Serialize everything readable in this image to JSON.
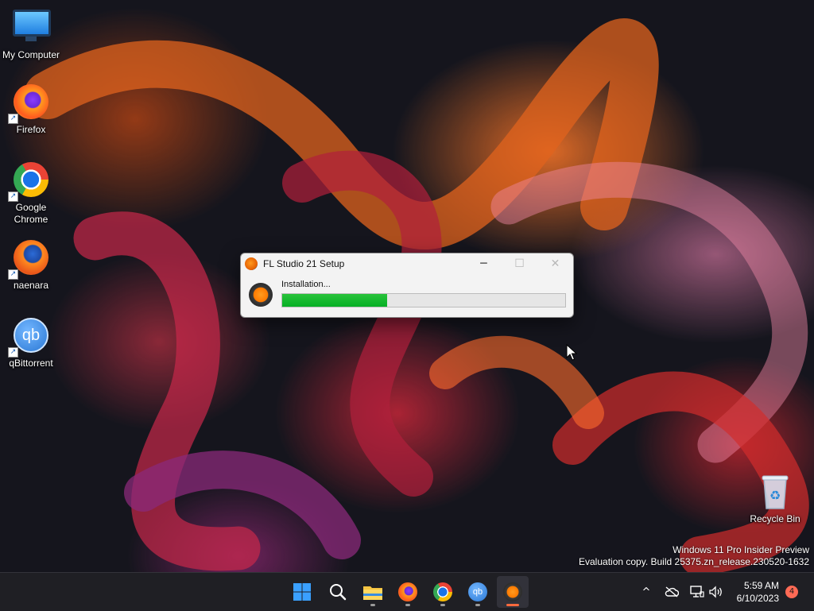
{
  "desktop": {
    "icons": [
      {
        "label": "My Computer",
        "icon": "monitor-icon"
      },
      {
        "label": "Firefox",
        "icon": "firefox-icon"
      },
      {
        "label": "Google\nChrome",
        "icon": "chrome-icon"
      },
      {
        "label": "naenara",
        "icon": "naenara-icon"
      },
      {
        "label": "qBittorrent",
        "icon": "qbittorrent-icon"
      },
      {
        "label": "Recycle Bin",
        "icon": "recycle-bin-icon"
      }
    ],
    "watermark": {
      "line1": "Windows 11 Pro Insider Preview",
      "line2": "Evaluation copy. Build 25375.zn_release.230520-1632"
    }
  },
  "setup_window": {
    "title": "FL Studio 21 Setup",
    "status": "Installation...",
    "progress": 0.37,
    "controls": {
      "minimize": "─",
      "maximize": "☐",
      "close": "✕"
    }
  },
  "qbittorrent_glyph": "qb",
  "taskbar": {
    "apps": [
      {
        "name": "start",
        "icon": "windows-logo-icon"
      },
      {
        "name": "search",
        "icon": "search-icon"
      },
      {
        "name": "file-explorer",
        "icon": "folder-icon"
      },
      {
        "name": "firefox",
        "icon": "firefox-icon"
      },
      {
        "name": "chrome",
        "icon": "chrome-icon"
      },
      {
        "name": "qbittorrent",
        "icon": "qbittorrent-icon"
      },
      {
        "name": "fl-studio",
        "icon": "fl-studio-icon",
        "active": true
      }
    ],
    "tray": {
      "chevron": "^",
      "time": "5:59 AM",
      "date": "6/10/2023",
      "notifications": "4"
    }
  },
  "colors": {
    "progress_fill": "#06b025",
    "taskbar_bg": "#1f1f24",
    "active_indicator": "#ff6a3d"
  }
}
